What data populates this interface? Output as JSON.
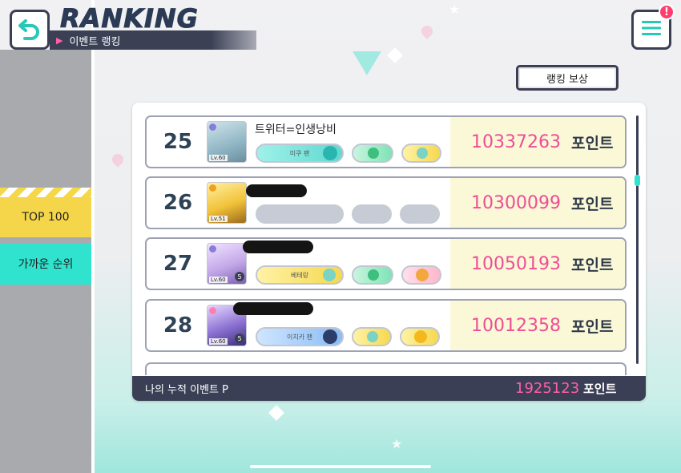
{
  "header": {
    "title": "RANKING",
    "subtitle": "이벤트 랭킹",
    "notification_badge": "!"
  },
  "reward_button": {
    "label": "랭킹 보상"
  },
  "left_tabs": [
    {
      "label": "TOP 100"
    },
    {
      "label": "가까운 순위"
    }
  ],
  "rows": [
    {
      "rank": "25",
      "name": "트위터=인생낭비",
      "level": "Lv.60",
      "chips": [
        "미쿠 팬",
        "",
        ""
      ],
      "score": "10337263",
      "unit": "포인트"
    },
    {
      "rank": "26",
      "name": "",
      "level": "Lv.51",
      "chips": [
        "",
        "",
        ""
      ],
      "score": "10300099",
      "unit": "포인트"
    },
    {
      "rank": "27",
      "name": "",
      "level": "Lv.60",
      "badge_count": "5",
      "chips": [
        "베테랑",
        "",
        ""
      ],
      "score": "10050193",
      "unit": "포인트"
    },
    {
      "rank": "28",
      "name": "",
      "level": "Lv.60",
      "badge_count": "5",
      "chips": [
        "이치카 팬",
        "",
        ""
      ],
      "score": "10012358",
      "unit": "포인트"
    }
  ],
  "footer": {
    "label": "나의 누적 이벤트 P",
    "total": "1925123",
    "unit": "포인트"
  },
  "colors": {
    "accent_teal": "#2fe3cf",
    "accent_yellow": "#f5d54a",
    "score_pink": "#ee4d95",
    "navy": "#3b3f55"
  }
}
